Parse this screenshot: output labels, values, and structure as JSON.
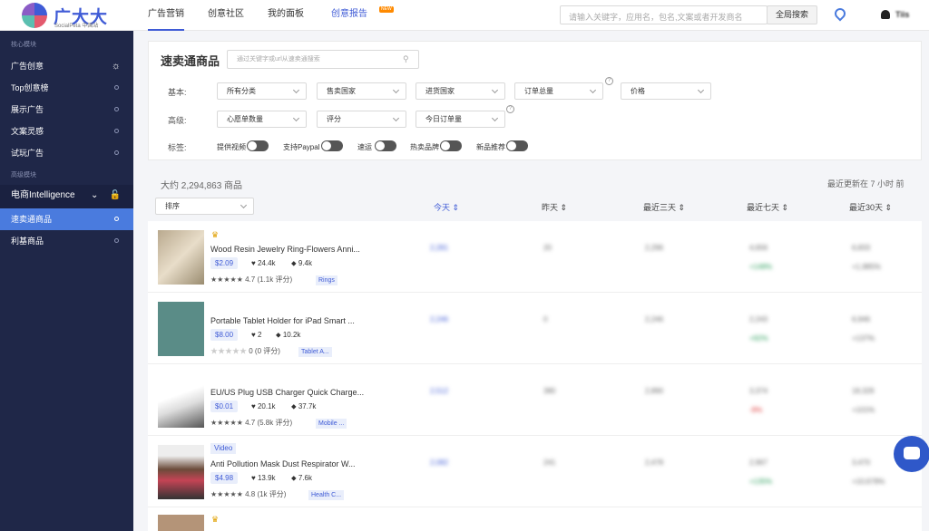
{
  "header": {
    "logo_text": "广大大",
    "logo_sub": "SocialPeta 中国站",
    "nav": [
      "广告营销",
      "创意社区",
      "我的面板",
      "创意报告"
    ],
    "nav_badge": "NEW",
    "search_placeholder": "请输入关键字，应用名，包名,文案或者开发商名",
    "search_button": "全局搜索",
    "user": "Tiis"
  },
  "sidebar": {
    "sec1": "核心模块",
    "items1": [
      "广告创意",
      "Top创意榜",
      "展示广告",
      "文案灵感",
      "试玩广告"
    ],
    "sec2": "高级模块",
    "group": "电商Intelligence",
    "items2": [
      "速卖通商品",
      "利基商品"
    ]
  },
  "filters": {
    "title": "速卖通商品",
    "search_placeholder": "通过关键字或url从速卖通搜索",
    "row1_label": "基本:",
    "row1": [
      "所有分类",
      "售卖国家",
      "进货国家",
      "订单总量",
      "价格"
    ],
    "row2_label": "高级:",
    "row2": [
      "心愿单数量",
      "评分",
      "今日订单量"
    ],
    "row3_label": "标签:",
    "toggles": [
      "提供视频",
      "支持Paypal",
      "速运",
      "热卖品牌",
      "新品推荐"
    ]
  },
  "summary": {
    "count": "大约 2,294,863 商品",
    "updated": "最近更新在 7 小时 前",
    "sort": "排序"
  },
  "columns": [
    "今天",
    "昨天",
    "最近三天",
    "最近七天",
    "最近30天"
  ],
  "products": [
    {
      "name": "Wood Resin Jewelry Ring-Flowers Anni...",
      "price": "$2.09",
      "likes": "24.4k",
      "tags": "9.4k",
      "rating": "4.7 (1.1k 评分)",
      "category": "Rings",
      "badge": "",
      "cols": [
        "2,281",
        "20",
        "2,296",
        "4,656",
        "6,833"
      ],
      "sub": [
        "",
        "",
        "",
        "+148%",
        "+1,985%"
      ],
      "thumb": "#b9a98e"
    },
    {
      "name": "Portable Tablet Holder for iPad Smart ...",
      "price": "$8.00",
      "likes": "2",
      "tags": "10.2k",
      "rating": "0 (0 评分)",
      "category": "Tablet A...",
      "badge": "",
      "cols": [
        "2,246",
        "0",
        "2,246",
        "2,243",
        "6,946"
      ],
      "sub": [
        "",
        "",
        "",
        "+92%",
        "+137%"
      ],
      "thumb": "#5a8c87"
    },
    {
      "name": "EU/US Plug USB Charger Quick Charge...",
      "price": "$0.01",
      "likes": "20.1k",
      "tags": "37.7k",
      "rating": "4.7 (5.8k 评分)",
      "category": "Mobile ...",
      "badge": "",
      "cols": [
        "2,512",
        "380",
        "2,890",
        "3,374",
        "18,329"
      ],
      "sub": [
        "",
        "",
        "",
        "-9%",
        "+101%"
      ],
      "thumb": "#e6e6e6"
    },
    {
      "name": "Anti Pollution Mask Dust Respirator W...",
      "price": "$4.98",
      "likes": "13.9k",
      "tags": "7.6k",
      "rating": "4.8 (1k 评分)",
      "category": "Health C...",
      "badge": "Video",
      "cols": [
        "2,082",
        "241",
        "2,478",
        "2,967",
        "3,470"
      ],
      "sub": [
        "",
        "",
        "",
        "+135%",
        "+10,678%"
      ],
      "thumb": "#c44455"
    }
  ]
}
